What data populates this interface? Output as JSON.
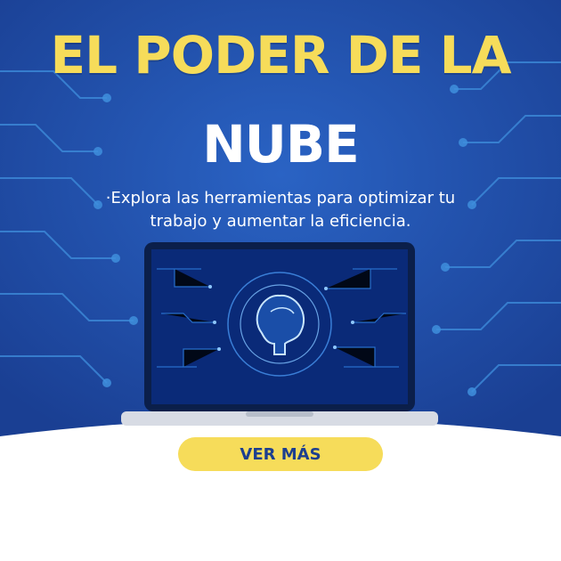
{
  "title": {
    "line1": "EL PODER DE LA",
    "line2": "NUBE"
  },
  "subtitle": "·Explora las herramientas para optimizar tu trabajo y aumentar la eficiencia.",
  "cta": {
    "label": "VER MÁS"
  },
  "colors": {
    "background_blue": "#1d4faa",
    "accent_yellow": "#f6dc5a",
    "circuit": "#3f8fdd",
    "screen": "#0a2a78"
  },
  "icons": {
    "laptop": "laptop-icon",
    "brain": "brain-circuit-icon"
  }
}
